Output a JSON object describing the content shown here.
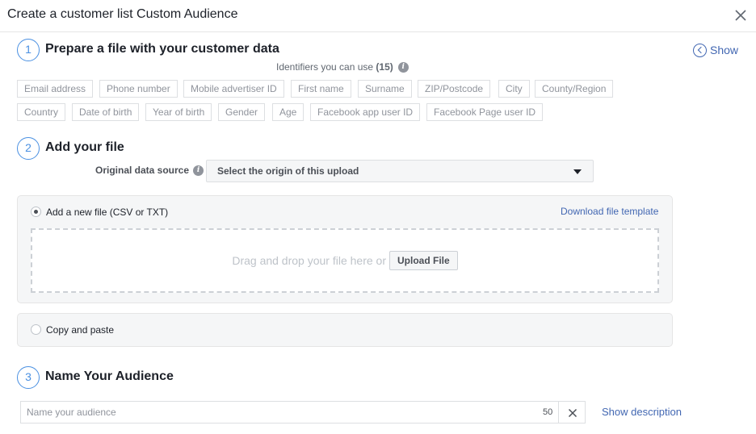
{
  "header": {
    "title": "Create a customer list Custom Audience"
  },
  "step1": {
    "number": "1",
    "title": "Prepare a file with your customer data",
    "show_label": "Show",
    "identifiers_caption": "Identifiers you can use",
    "identifiers_count": "(15)",
    "identifiers": [
      "Email address",
      "Phone number",
      "Mobile advertiser ID",
      "First name",
      "Surname",
      "ZIP/Postcode",
      "City",
      "County/Region",
      "Country",
      "Date of birth",
      "Year of birth",
      "Gender",
      "Age",
      "Facebook app user ID",
      "Facebook Page user ID"
    ]
  },
  "step2": {
    "number": "2",
    "title": "Add your file",
    "source_label": "Original data source",
    "source_placeholder": "Select the origin of this upload",
    "option_file_label": "Add a new file (CSV or TXT)",
    "download_template": "Download file template",
    "drop_hint": "Drag and drop your file here or",
    "upload_button": "Upload File",
    "option_paste_label": "Copy and paste"
  },
  "step3": {
    "number": "3",
    "title": "Name Your Audience",
    "name_placeholder": "Name your audience",
    "char_limit": "50",
    "show_description": "Show description"
  },
  "colors": {
    "accent": "#4a90e2",
    "link": "#4267b2",
    "panel_bg": "#f5f6f7",
    "border": "#dddfe2"
  }
}
